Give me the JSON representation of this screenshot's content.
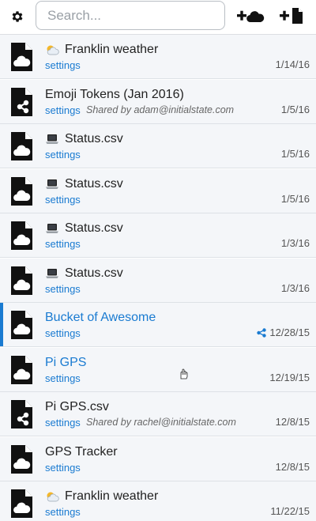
{
  "header": {
    "search_placeholder": "Search...",
    "settings_icon": "gear-icon",
    "add_stream_icon": "plus-cloud-icon",
    "add_bucket_icon": "plus-file-icon"
  },
  "colors": {
    "link": "#1a7bd1",
    "row_bg": "#f4f6f9",
    "active_indicator": "#1a7bd1"
  },
  "buckets": [
    {
      "title": "Franklin weather",
      "emoji": "sun-cloud-emoji",
      "icon": "cloud-document-icon",
      "settings": "settings",
      "shared_by": "",
      "date": "1/14/16",
      "link": false,
      "shared_icon": false
    },
    {
      "title": "Emoji Tokens (Jan 2016)",
      "emoji": "",
      "icon": "share-document-icon",
      "settings": "settings",
      "shared_by": "Shared by adam@initialstate.com",
      "date": "1/5/16",
      "link": false,
      "shared_icon": false
    },
    {
      "title": "Status.csv",
      "emoji": "laptop-emoji",
      "icon": "cloud-document-icon",
      "settings": "settings",
      "shared_by": "",
      "date": "1/5/16",
      "link": false,
      "shared_icon": false
    },
    {
      "title": "Status.csv",
      "emoji": "laptop-emoji",
      "icon": "cloud-document-icon",
      "settings": "settings",
      "shared_by": "",
      "date": "1/5/16",
      "link": false,
      "shared_icon": false
    },
    {
      "title": "Status.csv",
      "emoji": "laptop-emoji",
      "icon": "cloud-document-icon",
      "settings": "settings",
      "shared_by": "",
      "date": "1/3/16",
      "link": false,
      "shared_icon": false
    },
    {
      "title": "Status.csv",
      "emoji": "laptop-emoji",
      "icon": "cloud-document-icon",
      "settings": "settings",
      "shared_by": "",
      "date": "1/3/16",
      "link": false,
      "shared_icon": false
    },
    {
      "title": "Bucket of Awesome",
      "emoji": "",
      "icon": "cloud-document-icon",
      "settings": "settings",
      "shared_by": "",
      "date": "12/28/15",
      "link": true,
      "shared_icon": true,
      "active": true
    },
    {
      "title": "Pi GPS",
      "emoji": "",
      "icon": "cloud-document-icon",
      "settings": "settings",
      "shared_by": "",
      "date": "12/19/15",
      "link": true,
      "shared_icon": false
    },
    {
      "title": "Pi GPS.csv",
      "emoji": "",
      "icon": "share-document-icon",
      "settings": "settings",
      "shared_by": "Shared by rachel@initialstate.com",
      "date": "12/8/15",
      "link": false,
      "shared_icon": false
    },
    {
      "title": "GPS Tracker",
      "emoji": "",
      "icon": "cloud-document-icon",
      "settings": "settings",
      "shared_by": "",
      "date": "12/8/15",
      "link": false,
      "shared_icon": false
    },
    {
      "title": "Franklin weather",
      "emoji": "sun-cloud-emoji",
      "icon": "cloud-document-icon",
      "settings": "settings",
      "shared_by": "",
      "date": "11/22/15",
      "link": false,
      "shared_icon": false
    }
  ]
}
